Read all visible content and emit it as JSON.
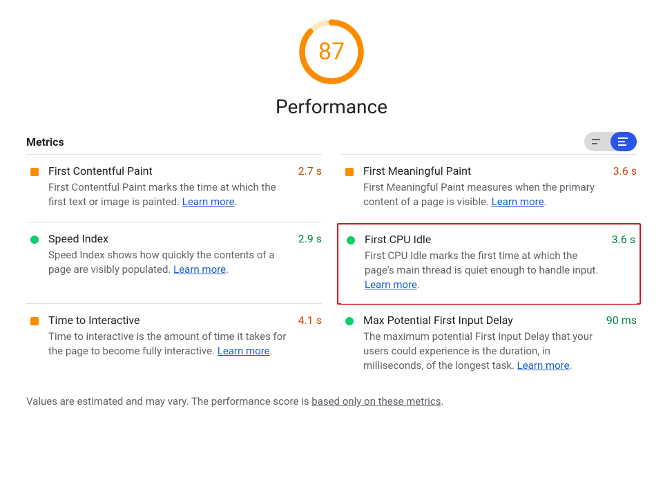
{
  "score": "87",
  "title": "Performance",
  "sectionHeading": "Metrics",
  "gauge": {
    "percent": 87,
    "color_arc": "#fb8c00",
    "color_bg": "#ffe6bf"
  },
  "learnMore": "Learn more",
  "metrics": {
    "fcp": {
      "title": "First Contentful Paint",
      "desc": "First Contentful Paint marks the time at which the first text or image is painted.",
      "value": "2.7 s"
    },
    "fmp": {
      "title": "First Meaningful Paint",
      "desc": "First Meaningful Paint measures when the primary content of a page is visible.",
      "value": "3.6 s"
    },
    "si": {
      "title": "Speed Index",
      "desc": "Speed Index shows how quickly the contents of a page are visibly populated.",
      "value": "2.9 s"
    },
    "cpu": {
      "title": "First CPU Idle",
      "desc": "First CPU Idle marks the first time at which the page's main thread is quiet enough to handle input.",
      "value": "3.6 s"
    },
    "tti": {
      "title": "Time to Interactive",
      "desc": "Time to interactive is the amount of time it takes for the page to become fully interactive.",
      "value": "4.1 s"
    },
    "mpfid": {
      "title": "Max Potential First Input Delay",
      "desc": "The maximum potential First Input Delay that your users could experience is the duration, in milliseconds, of the longest task.",
      "value": "90 ms"
    }
  },
  "footer": {
    "prefix": "Values are estimated and may vary. The performance score is ",
    "link": "based only on these metrics",
    "suffix": "."
  }
}
